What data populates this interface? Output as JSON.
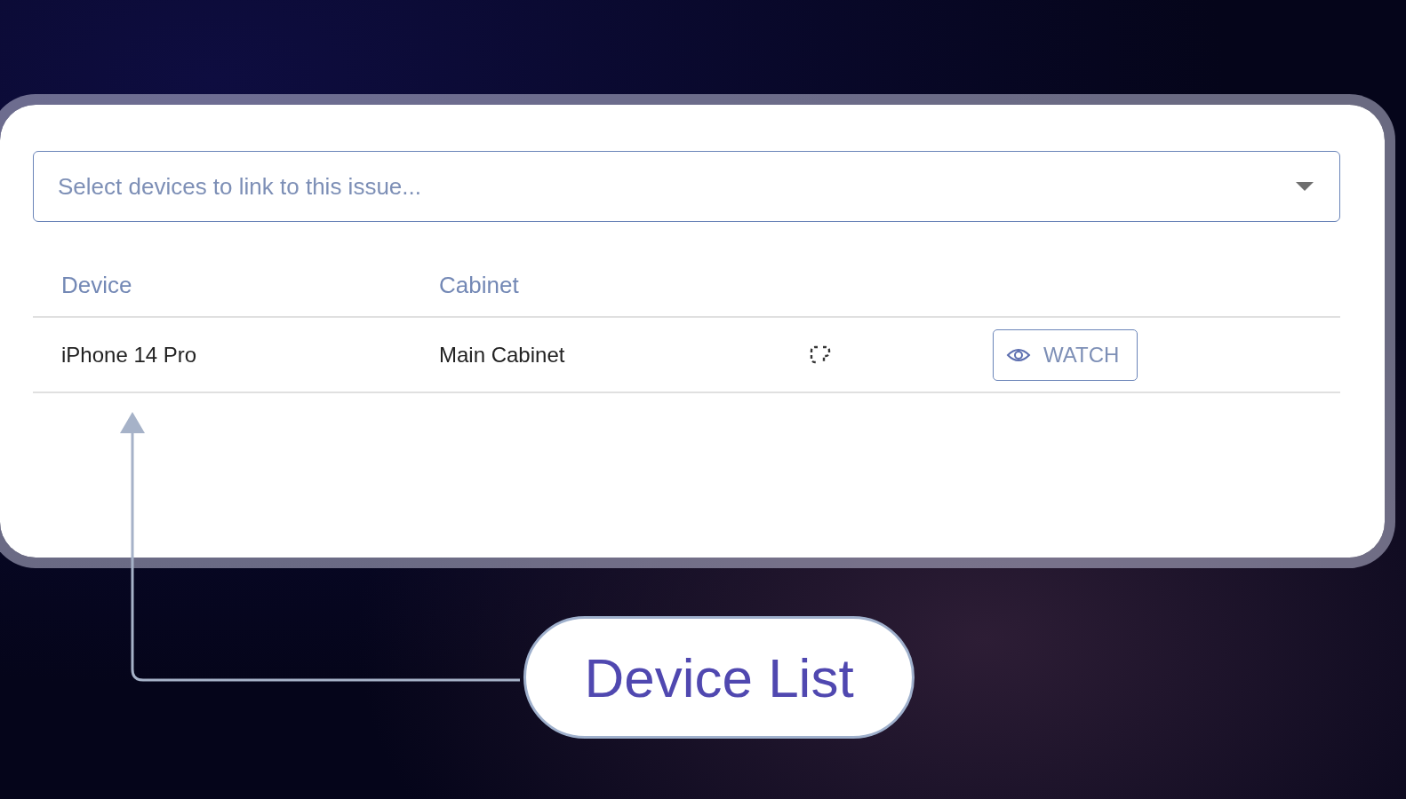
{
  "device_select": {
    "placeholder": "Select devices to link to this issue..."
  },
  "table": {
    "columns": [
      "Device",
      "Cabinet"
    ],
    "rows": [
      {
        "device": "iPhone 14 Pro",
        "cabinet": "Main Cabinet",
        "action": "WATCH"
      }
    ]
  },
  "callout": {
    "label": "Device List"
  }
}
